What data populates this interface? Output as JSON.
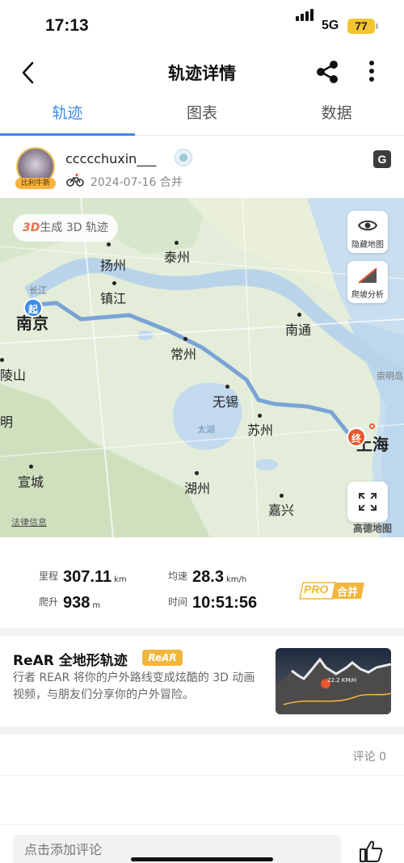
{
  "status_bar": {
    "time": "17:13",
    "network": "5G",
    "battery": "77"
  },
  "nav": {
    "title": "轨迹详情",
    "back_icon": "chevron-left-icon",
    "share_icon": "share-icon",
    "more_icon": "more-vertical-icon"
  },
  "tabs": [
    {
      "label": "轨迹",
      "active": true
    },
    {
      "label": "图表",
      "active": false
    },
    {
      "label": "数据",
      "active": false
    }
  ],
  "user": {
    "name": "ccccchuxin___",
    "badge": "比利牛斯",
    "date_info": "2024-07-16 合并"
  },
  "map": {
    "btn_3d_prefix": "3D",
    "btn_3d_text": "生成 3D 轨迹",
    "hide_map_label": "隐藏地图",
    "climb_label": "爬坡分析",
    "start_pin": "起",
    "end_pin": "终",
    "legal_link": "法律信息",
    "provider": "高德地图",
    "cities": [
      "扬州",
      "泰州",
      "镇江",
      "南京",
      "常州",
      "南通",
      "无锡",
      "苏州",
      "上海",
      "湖州",
      "宣城",
      "嘉兴",
      "崇明岛",
      "陵山",
      "明"
    ],
    "river_label": "长江",
    "lake_label": "太湖",
    "route_color": "#6e9ad6"
  },
  "stats": {
    "distance": {
      "label": "里程",
      "value": "307.11",
      "unit": "km"
    },
    "speed": {
      "label": "均速",
      "value": "28.3",
      "unit": "km/h"
    },
    "climb": {
      "label": "爬升",
      "value": "938",
      "unit": "m"
    },
    "time": {
      "label": "时间",
      "value": "10:51:56"
    },
    "pro_badge": "PRO",
    "merge_label": "合并"
  },
  "rear": {
    "title": "ReAR 全地形轨迹",
    "tag": "ReAR",
    "description": "行者 REAR 将你的户外路线变成炫酷的 3D 动画视频，与朋友们分享你的户外冒险。",
    "thumb_speed": "22.2 KM/H"
  },
  "comments": {
    "count_label": "评论 0",
    "input_placeholder": "点击添加评论"
  },
  "colors": {
    "accent": "#3d8be8",
    "start": "#3d8be8",
    "end": "#e8562e",
    "pro": "#f2b63d"
  }
}
